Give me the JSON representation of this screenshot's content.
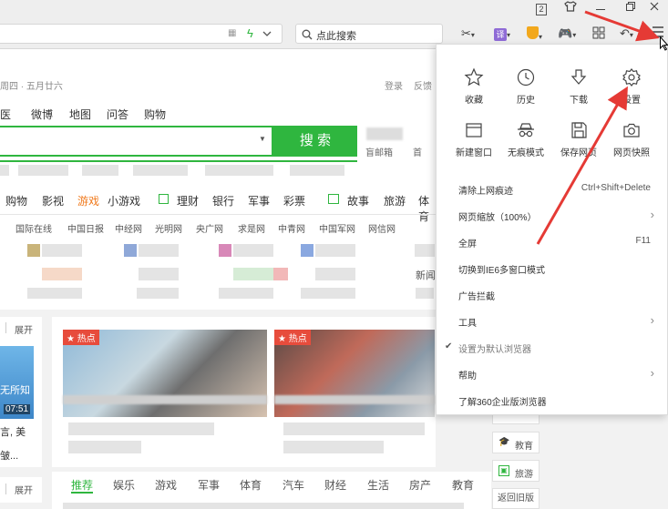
{
  "titlebar": {
    "badge": "2"
  },
  "toolbar": {
    "search_placeholder": "点此搜索"
  },
  "page": {
    "date": "周四 · 五月廿六",
    "login": "登录",
    "feedback": "反馈",
    "nav_links": [
      "医",
      "微博",
      "地图",
      "问答",
      "购物"
    ],
    "search_button": "搜 索",
    "side_links": [
      "盲邮箱",
      "首"
    ],
    "categories": [
      "购物",
      "影视",
      "游戏",
      "小游戏",
      "理财",
      "银行",
      "军事",
      "彩票",
      "故事",
      "旅游",
      "体育"
    ],
    "sites": [
      "国际在线",
      "中国日报",
      "中经网",
      "光明网",
      "央广网",
      "求是网",
      "中青网",
      "中国军网",
      "网信网"
    ],
    "left_expand": "展开",
    "left_expand2": "展开",
    "left_caption": [
      "无所知",
      "言, 美",
      "皱..."
    ],
    "left_time": "07:51",
    "hot_label": "热点",
    "hot_label2": "热点",
    "news_text": "新闻",
    "tabs": [
      "推荐",
      "娱乐",
      "游戏",
      "军事",
      "体育",
      "汽车",
      "财经",
      "生活",
      "房产",
      "教育"
    ],
    "right_tabs": [
      "教育",
      "旅游",
      "返回旧版"
    ]
  },
  "menu": {
    "top_row": [
      "收藏",
      "历史",
      "下载",
      "设置"
    ],
    "mid_row": [
      "新建窗口",
      "无痕模式",
      "保存网页",
      "网页快照"
    ],
    "items": [
      {
        "label": "清除上网痕迹",
        "shortcut": "Ctrl+Shift+Delete"
      },
      {
        "label": "网页缩放（100%）",
        "arrow": "›"
      },
      {
        "label": "全屏",
        "shortcut": "F11"
      },
      {
        "label": "切换到IE6多窗口模式"
      },
      {
        "label": "广告拦截"
      },
      {
        "label": "工具",
        "arrow": "›"
      },
      {
        "label": "设置为默认浏览器",
        "check": "✔"
      },
      {
        "label": "帮助",
        "arrow": "›"
      },
      {
        "label": "了解360企业版浏览器"
      }
    ]
  },
  "colors": {
    "accent_green": "#2fb63f",
    "arrow_red": "#e53a35",
    "hot_red": "#e74c3c"
  }
}
